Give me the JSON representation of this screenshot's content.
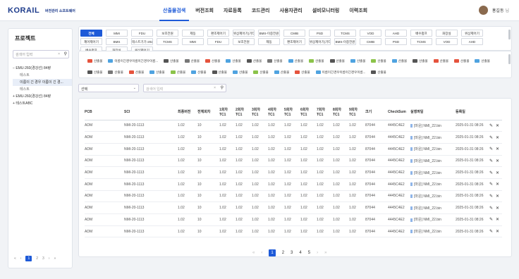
{
  "header": {
    "logo": "KORAIL",
    "logo_sub": "버전관리 소프트웨어",
    "nav": [
      "산출물검색",
      "버전조회",
      "자료등록",
      "코드관리",
      "사용자관리",
      "설비모니터링",
      "이력조회"
    ],
    "user": "홍길동",
    "user_suffix": "님"
  },
  "sidebar": {
    "title": "프로젝트",
    "search_placeholder": "검색어 입력",
    "tree": [
      {
        "label": "EMU-260(경강선) 84량",
        "type": "open"
      },
      {
        "label": "테스트",
        "type": "sub"
      },
      {
        "label": "이름이 긴 경우 이름이 긴 경...",
        "type": "sel"
      },
      {
        "label": "테스트",
        "type": "sub"
      },
      {
        "label": "EMU-260(경강선) 84량",
        "type": "closed"
      },
      {
        "label": "테스트ABC",
        "type": "closed"
      }
    ],
    "pages": [
      "«",
      "‹",
      "1",
      "2",
      "3",
      "›",
      "»"
    ],
    "current_page": "1"
  },
  "tags": [
    "전체",
    "MMI",
    "FDU",
    "보조전원",
    "제동",
    "편조제어기",
    "위상제어기(기타)",
    "BMS-이중전원",
    "CMIB",
    "PSD",
    "TCMS",
    "VOD",
    "AHD",
    "배수펌프",
    "화장실",
    "위상제어기",
    "제어제어기",
    "BMS",
    "테스트기기-2025A",
    "TCMS",
    "MMI",
    "FDU",
    "보조전원",
    "제동",
    "편조제어기",
    "위상제어기(기타)",
    "BMS-이중전원",
    "CMIB",
    "PSD",
    "TCMS",
    "VOD",
    "AHD",
    "배수펌프",
    "화장실",
    "위상제어기"
  ],
  "icon_buttons": [
    {
      "label": "산출물",
      "color": "#e5533d"
    },
    {
      "label": "이름이긴경우이름이긴경우이름...",
      "color": "#4fa3e0"
    },
    {
      "label": "산출물",
      "color": "#555555"
    },
    {
      "label": "산출물",
      "color": "#777777"
    },
    {
      "label": "산출물",
      "color": "#e5533d"
    },
    {
      "label": "산출물",
      "color": "#4fa3e0"
    },
    {
      "label": "산출물",
      "color": "#555555"
    },
    {
      "label": "산출물",
      "color": "#777777"
    },
    {
      "label": "산출물",
      "color": "#4fa3e0"
    },
    {
      "label": "산출물",
      "color": "#8bc34a"
    },
    {
      "label": "산출물",
      "color": "#555555"
    },
    {
      "label": "산출물",
      "color": "#4fa3e0"
    },
    {
      "label": "산출물",
      "color": "#8bc34a"
    },
    {
      "label": "산출물",
      "color": "#4fa3e0"
    },
    {
      "label": "산출물",
      "color": "#555555"
    },
    {
      "label": "산출물",
      "color": "#e5533d"
    },
    {
      "label": "산출물",
      "color": "#e5533d"
    },
    {
      "label": "산출물",
      "color": "#4fa3e0"
    },
    {
      "label": "산출물",
      "color": "#555555"
    },
    {
      "label": "산출물",
      "color": "#777777"
    },
    {
      "label": "산출물",
      "color": "#e5533d"
    },
    {
      "label": "산출물",
      "color": "#4fa3e0"
    },
    {
      "label": "산출물",
      "color": "#8bc34a"
    },
    {
      "label": "산출물",
      "color": "#4fa3e0"
    },
    {
      "label": "산출물",
      "color": "#555555"
    },
    {
      "label": "산출물",
      "color": "#4fa3e0"
    },
    {
      "label": "산출물",
      "color": "#8bc34a"
    },
    {
      "label": "산출물",
      "color": "#4fa3e0"
    },
    {
      "label": "산출물",
      "color": "#e5533d"
    },
    {
      "label": "이름이긴경우이름이긴경우이름...",
      "color": "#4fa3e0"
    },
    {
      "label": "산출물",
      "color": "#555555"
    }
  ],
  "filter": {
    "select_value": "선택",
    "search_placeholder": "검색어 입력"
  },
  "table": {
    "headers": [
      "PCB",
      "SCI",
      "최종버전",
      "전체회차",
      "1회차\nTC1",
      "2회차\nTC1",
      "3회차\nTC1",
      "4회차\nTC1",
      "5회차\nTC1",
      "6회차\nTC1",
      "7회차\nTC1",
      "8회차\nTC1",
      "9회차\nTC1",
      "크기",
      "CheckSum",
      "실행파일",
      "등록일",
      ""
    ],
    "rows": [
      [
        "ADM",
        "NMI-20-1113",
        "1.02",
        "10",
        "1.02",
        "1.02",
        "1.02",
        "1.02",
        "1.02",
        "1.02",
        "1.02",
        "1.02",
        "1.02",
        "87044",
        "4445C4E2",
        "[마운] NMI_22.bin",
        "2025-01-31 08:26"
      ],
      [
        "ADM",
        "NMI-20-1113",
        "1.02",
        "10",
        "1.02",
        "1.02",
        "1.02",
        "1.02",
        "1.02",
        "1.02",
        "1.02",
        "1.02",
        "1.02",
        "87044",
        "4445C4E2",
        "[마운] NMI_22.bin",
        "2025-01-31 08:26"
      ],
      [
        "ADM",
        "NMI-20-1113",
        "1.02",
        "10",
        "1.02",
        "1.02",
        "1.02",
        "1.02",
        "1.02",
        "1.02",
        "1.02",
        "1.02",
        "1.02",
        "87044",
        "4445C4E2",
        "[마운] NMI_22.bin",
        "2025-01-31 08:26"
      ],
      [
        "ADM",
        "NMI-20-1113",
        "1.02",
        "10",
        "1.02",
        "1.02",
        "1.02",
        "1.02",
        "1.02",
        "1.02",
        "1.02",
        "1.02",
        "1.02",
        "87044",
        "4445C4E2",
        "[마운] NMI_22.bin",
        "2025-01-31 08:26"
      ],
      [
        "ADM",
        "NMI-20-1113",
        "1.02",
        "10",
        "1.02",
        "1.02",
        "1.02",
        "1.02",
        "1.02",
        "1.02",
        "1.02",
        "1.02",
        "1.02",
        "87044",
        "4445C4E2",
        "[마운] NMI_22.bin",
        "2025-01-31 08:26"
      ],
      [
        "ADM",
        "NMI-20-1113",
        "1.02",
        "10",
        "1.02",
        "1.02",
        "1.02",
        "1.02",
        "1.02",
        "1.02",
        "1.02",
        "1.02",
        "1.02",
        "87044",
        "4445C4E2",
        "[마운] NMI_22.bin",
        "2025-01-31 08:26"
      ],
      [
        "ADM",
        "NMI-20-1113",
        "1.02",
        "10",
        "1.02",
        "1.02",
        "1.02",
        "1.02",
        "1.02",
        "1.02",
        "1.02",
        "1.02",
        "1.02",
        "87044",
        "4445C4E2",
        "[마운] NMI_22.bin",
        "2025-01-31 08:26"
      ],
      [
        "ADM",
        "NMI-20-1113",
        "1.02",
        "10",
        "1.02",
        "1.02",
        "1.02",
        "1.02",
        "1.02",
        "1.02",
        "1.02",
        "1.02",
        "1.02",
        "87044",
        "4445C4E2",
        "[마운] NMI_22.bin",
        "2025-01-31 08:26"
      ],
      [
        "ADM",
        "NMI-20-1113",
        "1.02",
        "10",
        "1.02",
        "1.02",
        "1.02",
        "1.02",
        "1.02",
        "1.02",
        "1.02",
        "1.02",
        "1.02",
        "87044",
        "4445C4E2",
        "[마운] NMI_22.bin",
        "2025-01-31 08:26"
      ],
      [
        "ADM",
        "NMI-20-1113",
        "1.02",
        "10",
        "1.02",
        "1.02",
        "1.02",
        "1.02",
        "1.02",
        "1.02",
        "1.02",
        "1.02",
        "1.02",
        "87044",
        "4445C4E2",
        "[마운] NMI_22.bin",
        "2025-01-31 08:26"
      ]
    ],
    "pages": [
      "«",
      "‹",
      "1",
      "2",
      "3",
      "4",
      "5",
      "›",
      "»"
    ],
    "current_page": "1"
  }
}
